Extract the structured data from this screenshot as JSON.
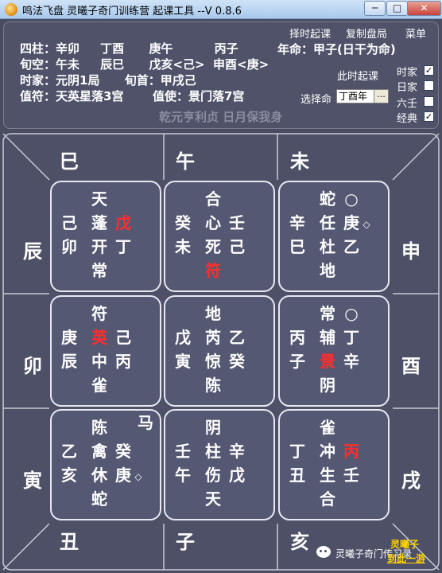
{
  "window": {
    "title": "鸣法飞盘    灵曦子奇门训练营 起课工具 --V 0.8.6",
    "minimize": "─",
    "maximize": "□",
    "close": "✕"
  },
  "menu": {
    "zeshi": "择时起课",
    "copy": "复制盘局",
    "menu": "菜单"
  },
  "info": {
    "line1": "四柱：辛卯     丁酉      庚午          丙子",
    "line2": "旬空：午未     辰巳      戊亥<己>  申酉<庚>",
    "line3": "时家：元阴1局      旬首：甲戌己",
    "line4": "值符：天英星落3宫       值使：景门落7宫",
    "nianming": "年命：甲子(日干为命)",
    "cishi": "此时起课",
    "xuanze_label": "选择命",
    "xuanze_value": "丁酉年",
    "xuanze_btn": "...",
    "motto": "乾元亨利贞 日月保我身"
  },
  "checkboxes": [
    {
      "label": "时家",
      "checked": true,
      "mark": "✓"
    },
    {
      "label": "日家",
      "checked": false,
      "mark": ""
    },
    {
      "label": "六壬",
      "checked": false,
      "mark": ""
    },
    {
      "label": "经典",
      "checked": true,
      "mark": "✓"
    }
  ],
  "zhi": {
    "si": "巳",
    "wu": "午",
    "wei": "未",
    "chen": "辰",
    "shen": "申",
    "mao": "卯",
    "you": "酉",
    "yin": "寅",
    "xu": "戌",
    "chou": "丑",
    "zi": "子",
    "hai": "亥"
  },
  "palaces": {
    "p4": {
      "star": "天",
      "l_top": "己",
      "l_bot": "卯",
      "m1": "蓬",
      "m2": "开",
      "m3": "常",
      "r_top": "戊",
      "r_bot": "丁"
    },
    "p9": {
      "m0": "合",
      "l_top": "癸",
      "l_bot": "未",
      "m1": "心",
      "m2": "死",
      "m3": "符",
      "r_top": "壬",
      "r_bot": "己"
    },
    "p2": {
      "m0": "蛇",
      "l_top": "辛",
      "l_bot": "巳",
      "m1": "任",
      "m2": "杜",
      "m3": "地",
      "r_top": "○",
      "r_mid": "庚",
      "r_bot": "乙",
      "mark": "◇"
    },
    "p3": {
      "m0": "符",
      "l_top": "庚",
      "l_bot": "辰",
      "m1": "英",
      "m2": "中",
      "m3": "雀",
      "r_top": "己",
      "r_bot": "丙"
    },
    "p5": {
      "m0": "地",
      "l_top": "戊",
      "l_bot": "寅",
      "m1": "芮",
      "m2": "惊",
      "m3": "陈",
      "r_top": "乙",
      "r_bot": "癸"
    },
    "p7": {
      "m0": "常",
      "l_top": "丙",
      "l_bot": "子",
      "m1": "辅",
      "m2": "景",
      "m3": "阴",
      "r_top": "○",
      "r_mid": "丁",
      "r_bot": "辛"
    },
    "p8": {
      "horse": "马",
      "m0": "陈",
      "l_top": "乙",
      "l_bot": "亥",
      "m1": "禽",
      "m2": "休",
      "m3": "蛇",
      "r_top": "癸",
      "r_bot": "庚",
      "mark": "◇"
    },
    "p1": {
      "m0": "阴",
      "l_top": "壬",
      "l_bot": "午",
      "m1": "柱",
      "m2": "伤",
      "m3": "天",
      "r_top": "辛",
      "r_bot": "戊"
    },
    "p6": {
      "m0": "雀",
      "l_top": "丁",
      "l_bot": "丑",
      "m1": "冲",
      "m2": "生",
      "m3": "合",
      "r_top": "丙",
      "r_bot": "壬"
    }
  },
  "watermark": {
    "line1": "灵曦子",
    "line2": "到此一游",
    "wechat": "灵曦子奇门传习录"
  },
  "colors": {
    "background": "#4a4d62",
    "palace": "#545872",
    "highlight": "#ff2d2d",
    "watermark": "#ffd400"
  }
}
